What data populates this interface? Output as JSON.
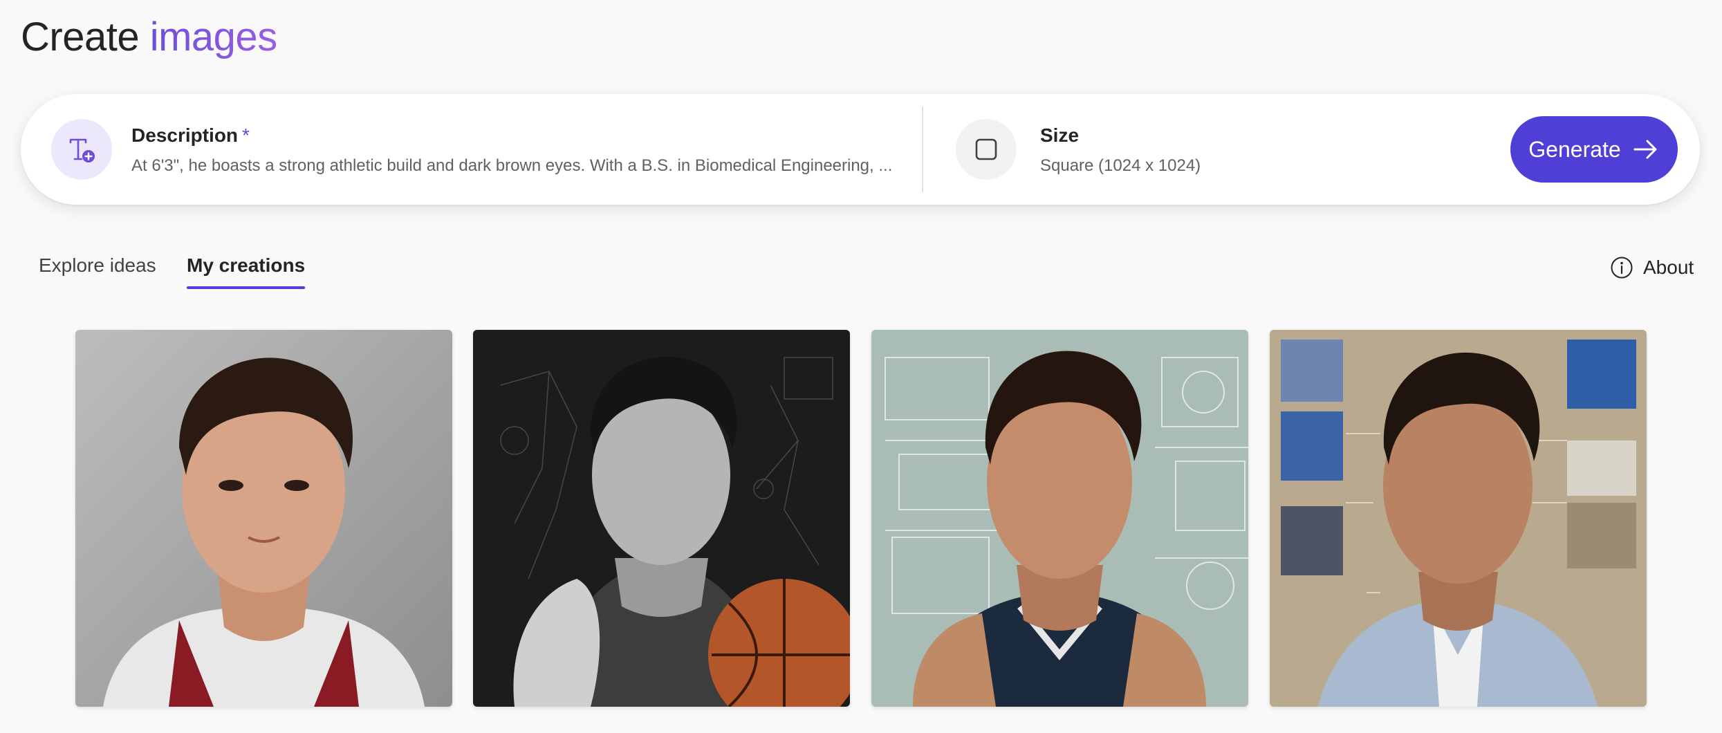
{
  "header": {
    "title_plain": "Create",
    "title_accent": "images"
  },
  "prompt": {
    "description_label": "Description",
    "required_mark": "*",
    "description_value": "At 6'3\", he boasts a strong athletic build and dark brown eyes. With a B.S. in Biomedical Engineering, ...",
    "size_label": "Size",
    "size_value": "Square (1024 x 1024)",
    "generate_label": "Generate"
  },
  "tabs": [
    {
      "label": "Explore ideas",
      "selected": false
    },
    {
      "label": "My creations",
      "selected": true
    }
  ],
  "about_label": "About",
  "gallery": {
    "count": 4
  },
  "colors": {
    "accent": "#4f3fd6",
    "title_gradient_start": "#6b4fd8",
    "title_gradient_end": "#9a5de6",
    "background": "#f9f9f9"
  },
  "icons": {
    "description": "text-add-icon",
    "size": "square-icon",
    "generate": "arrow-right-icon",
    "about": "info-icon"
  }
}
